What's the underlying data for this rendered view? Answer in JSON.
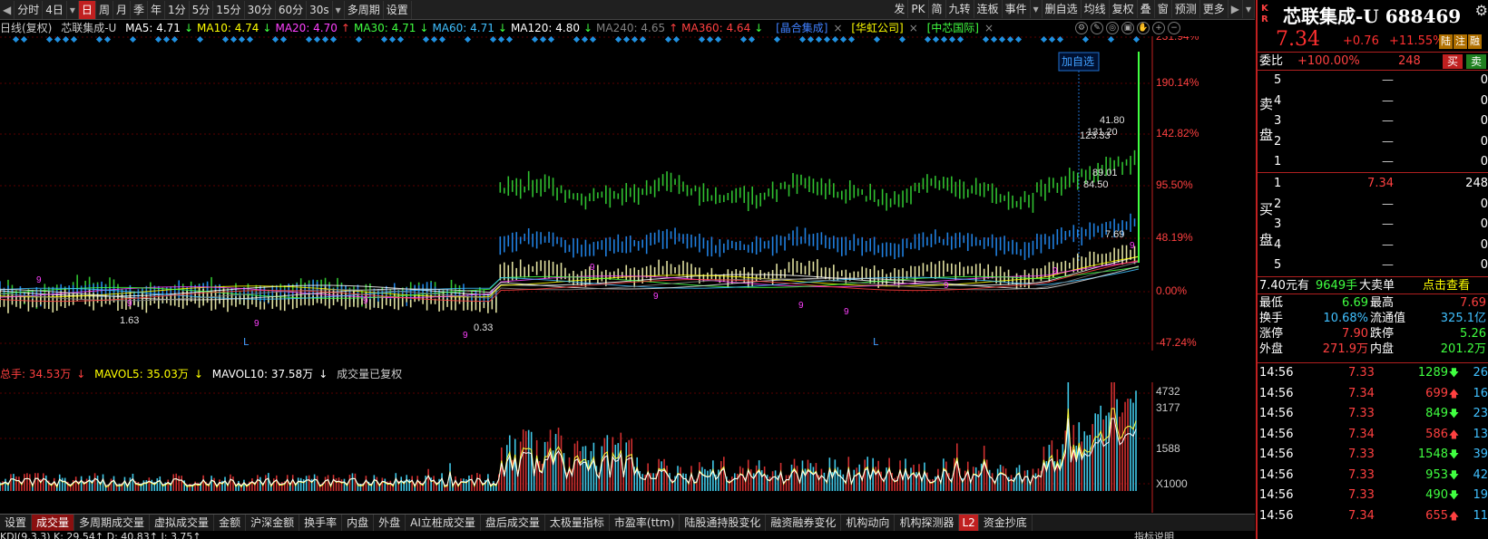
{
  "toolbar": {
    "items": [
      "分时",
      "4日",
      "日",
      "周",
      "月",
      "季",
      "年",
      "1分",
      "5分",
      "15分",
      "30分",
      "60分",
      "30s",
      "多周期",
      "设置"
    ],
    "active_index": 2,
    "right_items": [
      "发",
      "PK",
      "简",
      "九转",
      "连板",
      "事件",
      "删自选",
      "均线",
      "复权",
      "叠",
      "窗",
      "预测",
      "更多"
    ]
  },
  "info": {
    "period": "日线(复权)",
    "name": "芯联集成-U",
    "ma": [
      {
        "label": "MA5: 4.71",
        "arrow": "↓",
        "color": "#ffffff"
      },
      {
        "label": "MA10: 4.74",
        "arrow": "↓",
        "color": "#ffff00"
      },
      {
        "label": "MA20: 4.70",
        "arrow": "↑",
        "color": "#ff40ff"
      },
      {
        "label": "MA30: 4.71",
        "arrow": "↓",
        "color": "#40ff40"
      },
      {
        "label": "MA60: 4.71",
        "arrow": "↓",
        "color": "#40c0ff"
      },
      {
        "label": "MA120: 4.80",
        "arrow": "↓",
        "color": "#ffffff"
      },
      {
        "label": "MA240: 4.65",
        "arrow": "↑",
        "color": "#808080"
      },
      {
        "label": "MA360: 4.64",
        "arrow": "↓",
        "color": "#ff4040"
      }
    ],
    "tags": [
      {
        "label": "[晶合集成]",
        "color": "#4080ff"
      },
      {
        "label": "[华虹公司]",
        "color": "#ffff00"
      },
      {
        "label": "[中芯国际]",
        "color": "#40ff40"
      }
    ],
    "close_icon": "×"
  },
  "axis": {
    "right_labels": [
      "231.94%",
      "190.14%",
      "142.82%",
      "95.50%",
      "48.19%",
      "0.00%",
      "-47.24%"
    ],
    "vol_labels": [
      "4732",
      "3177",
      "1588",
      "X1000"
    ]
  },
  "annotations": {
    "add_watch": "加自选",
    "price_labels": [
      "41.80",
      "131.20",
      "123.33",
      "89.01",
      "84.50",
      "7.69",
      "1.63",
      "0.33"
    ],
    "L": "L",
    "nine": "9"
  },
  "vol": {
    "total": "总手: 34.53万",
    "total_arrow": "↓",
    "mavol5": "MAVOL5: 35.03万",
    "mavol5_arrow": "↓",
    "mavol10": "MAVOL10: 37.58万",
    "mavol10_arrow": "↓",
    "note": "成交量已复权"
  },
  "tabs": [
    "设置",
    "成交量",
    "多周期成交量",
    "虚拟成交量",
    "金额",
    "沪深金额",
    "换手率",
    "内盘",
    "外盘",
    "AI立桩成交量",
    "盘后成交量",
    "太极量指标",
    "市盈率(ttm)",
    "陆股通持股变化",
    "融资融券变化",
    "机构动向",
    "机构探测器",
    "L2",
    "资金抄底"
  ],
  "tab_active_index": 1,
  "bottom_text": "KDJ(9,3,3) K: 29.54↑ D: 40.83↑ J: 3.75↑",
  "bottom_right": "指标说明",
  "stock": {
    "kr": [
      "K",
      "R"
    ],
    "name": "芯联集成-U 688469",
    "price": "7.34",
    "change": "+0.76",
    "pct": "+11.55%",
    "badges": [
      {
        "t": "陆",
        "c": "#c08000"
      },
      {
        "t": "注",
        "c": "#c08000"
      },
      {
        "t": "融",
        "c": "#c08000"
      }
    ]
  },
  "weibi": {
    "label": "委比",
    "pct": "+100.00%",
    "diff": "248",
    "buy": "买",
    "sell": "卖"
  },
  "orderbook": {
    "sell_label": [
      "卖",
      "盘"
    ],
    "buy_label": [
      "买",
      "盘"
    ],
    "sell": [
      {
        "lv": "5",
        "pr": "—",
        "vo": "0"
      },
      {
        "lv": "4",
        "pr": "—",
        "vo": "0"
      },
      {
        "lv": "3",
        "pr": "—",
        "vo": "0"
      },
      {
        "lv": "2",
        "pr": "—",
        "vo": "0"
      },
      {
        "lv": "1",
        "pr": "—",
        "vo": "0"
      }
    ],
    "buy": [
      {
        "lv": "1",
        "pr": "7.34",
        "vo": "248"
      },
      {
        "lv": "2",
        "pr": "—",
        "vo": "0"
      },
      {
        "lv": "3",
        "pr": "—",
        "vo": "0"
      },
      {
        "lv": "4",
        "pr": "—",
        "vo": "0"
      },
      {
        "lv": "5",
        "pr": "—",
        "vo": "0"
      }
    ]
  },
  "bigorder": {
    "a": "7.40元有",
    "b": "9649手",
    "c": "大卖单",
    "d": "点击查看"
  },
  "stats": [
    {
      "l1": "最低",
      "v1": "6.69",
      "c1": "#40ff40",
      "l2": "最高",
      "v2": "7.69",
      "c2": "#ff4040"
    },
    {
      "l1": "换手",
      "v1": "10.68%",
      "c1": "#40c0ff",
      "l2": "流通值",
      "v2": "325.1亿",
      "c2": "#40c0ff"
    },
    {
      "l1": "涨停",
      "v1": "7.90",
      "c1": "#ff4040",
      "l2": "跌停",
      "v2": "5.26",
      "c2": "#40ff40"
    },
    {
      "l1": "外盘",
      "v1": "271.9万",
      "c1": "#ff4040",
      "l2": "内盘",
      "v2": "201.2万",
      "c2": "#40ff40"
    }
  ],
  "ticks": [
    {
      "t": "14:56",
      "p": "7.33",
      "v": "1289",
      "d": "down",
      "n": "26"
    },
    {
      "t": "14:56",
      "p": "7.34",
      "v": "699",
      "d": "up",
      "n": "16"
    },
    {
      "t": "14:56",
      "p": "7.33",
      "v": "849",
      "d": "down",
      "n": "23"
    },
    {
      "t": "14:56",
      "p": "7.34",
      "v": "586",
      "d": "up",
      "n": "13"
    },
    {
      "t": "14:56",
      "p": "7.33",
      "v": "1548",
      "d": "down",
      "n": "39"
    },
    {
      "t": "14:56",
      "p": "7.33",
      "v": "953",
      "d": "down",
      "n": "42"
    },
    {
      "t": "14:56",
      "p": "7.33",
      "v": "490",
      "d": "down",
      "n": "19"
    },
    {
      "t": "14:56",
      "p": "7.34",
      "v": "655",
      "d": "up",
      "n": "11"
    }
  ]
}
